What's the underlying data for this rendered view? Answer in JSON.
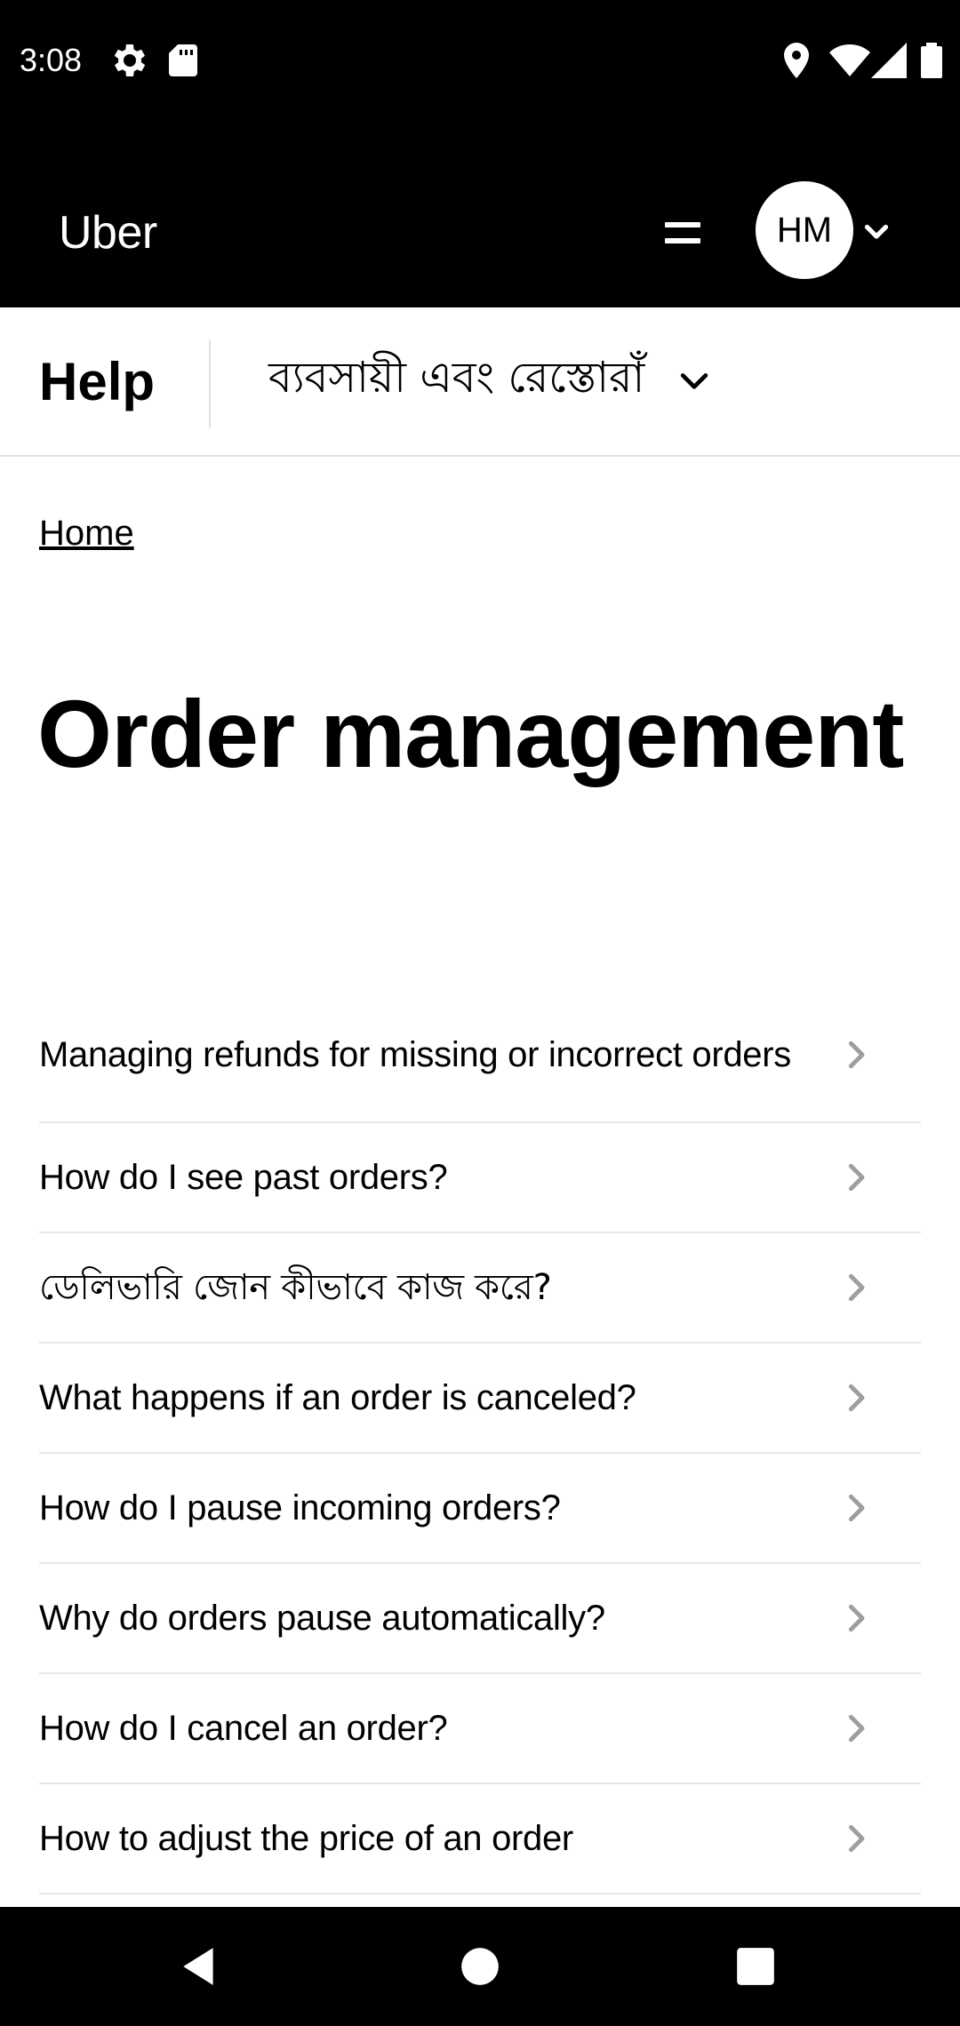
{
  "status_bar": {
    "time": "3:08",
    "icons": [
      "gear-icon",
      "sd-card-icon",
      "location-icon",
      "wifi-icon",
      "signal-icon",
      "battery-icon"
    ]
  },
  "top_nav": {
    "brand": "Uber",
    "menu_icon": "hamburger-icon",
    "avatar_initials": "HM",
    "avatar_chevron_icon": "chevron-down-icon"
  },
  "help_header": {
    "title": "Help",
    "category": "ব্যবসায়ী এবং রেস্তোরাঁ",
    "category_chevron_icon": "chevron-down-icon"
  },
  "breadcrumb": {
    "home": "Home"
  },
  "page": {
    "title": "Order management"
  },
  "articles": [
    {
      "label": "Managing refunds for missing or incorrect orders"
    },
    {
      "label": "How do I see past orders?"
    },
    {
      "label": "ডেলিভারি জোন কীভাবে কাজ করে?"
    },
    {
      "label": "What happens if an order is canceled?"
    },
    {
      "label": "How do I pause incoming orders?"
    },
    {
      "label": "Why do orders pause automatically?"
    },
    {
      "label": "How do I cancel an order?"
    },
    {
      "label": "How to adjust the price of an order"
    }
  ],
  "system_nav": {
    "back_icon": "back-triangle-icon",
    "home_icon": "home-circle-icon",
    "recents_icon": "recents-square-icon"
  },
  "colors": {
    "header_bg": "#000000",
    "divider": "#e2e2e2",
    "chevron": "#9e9e9e"
  }
}
